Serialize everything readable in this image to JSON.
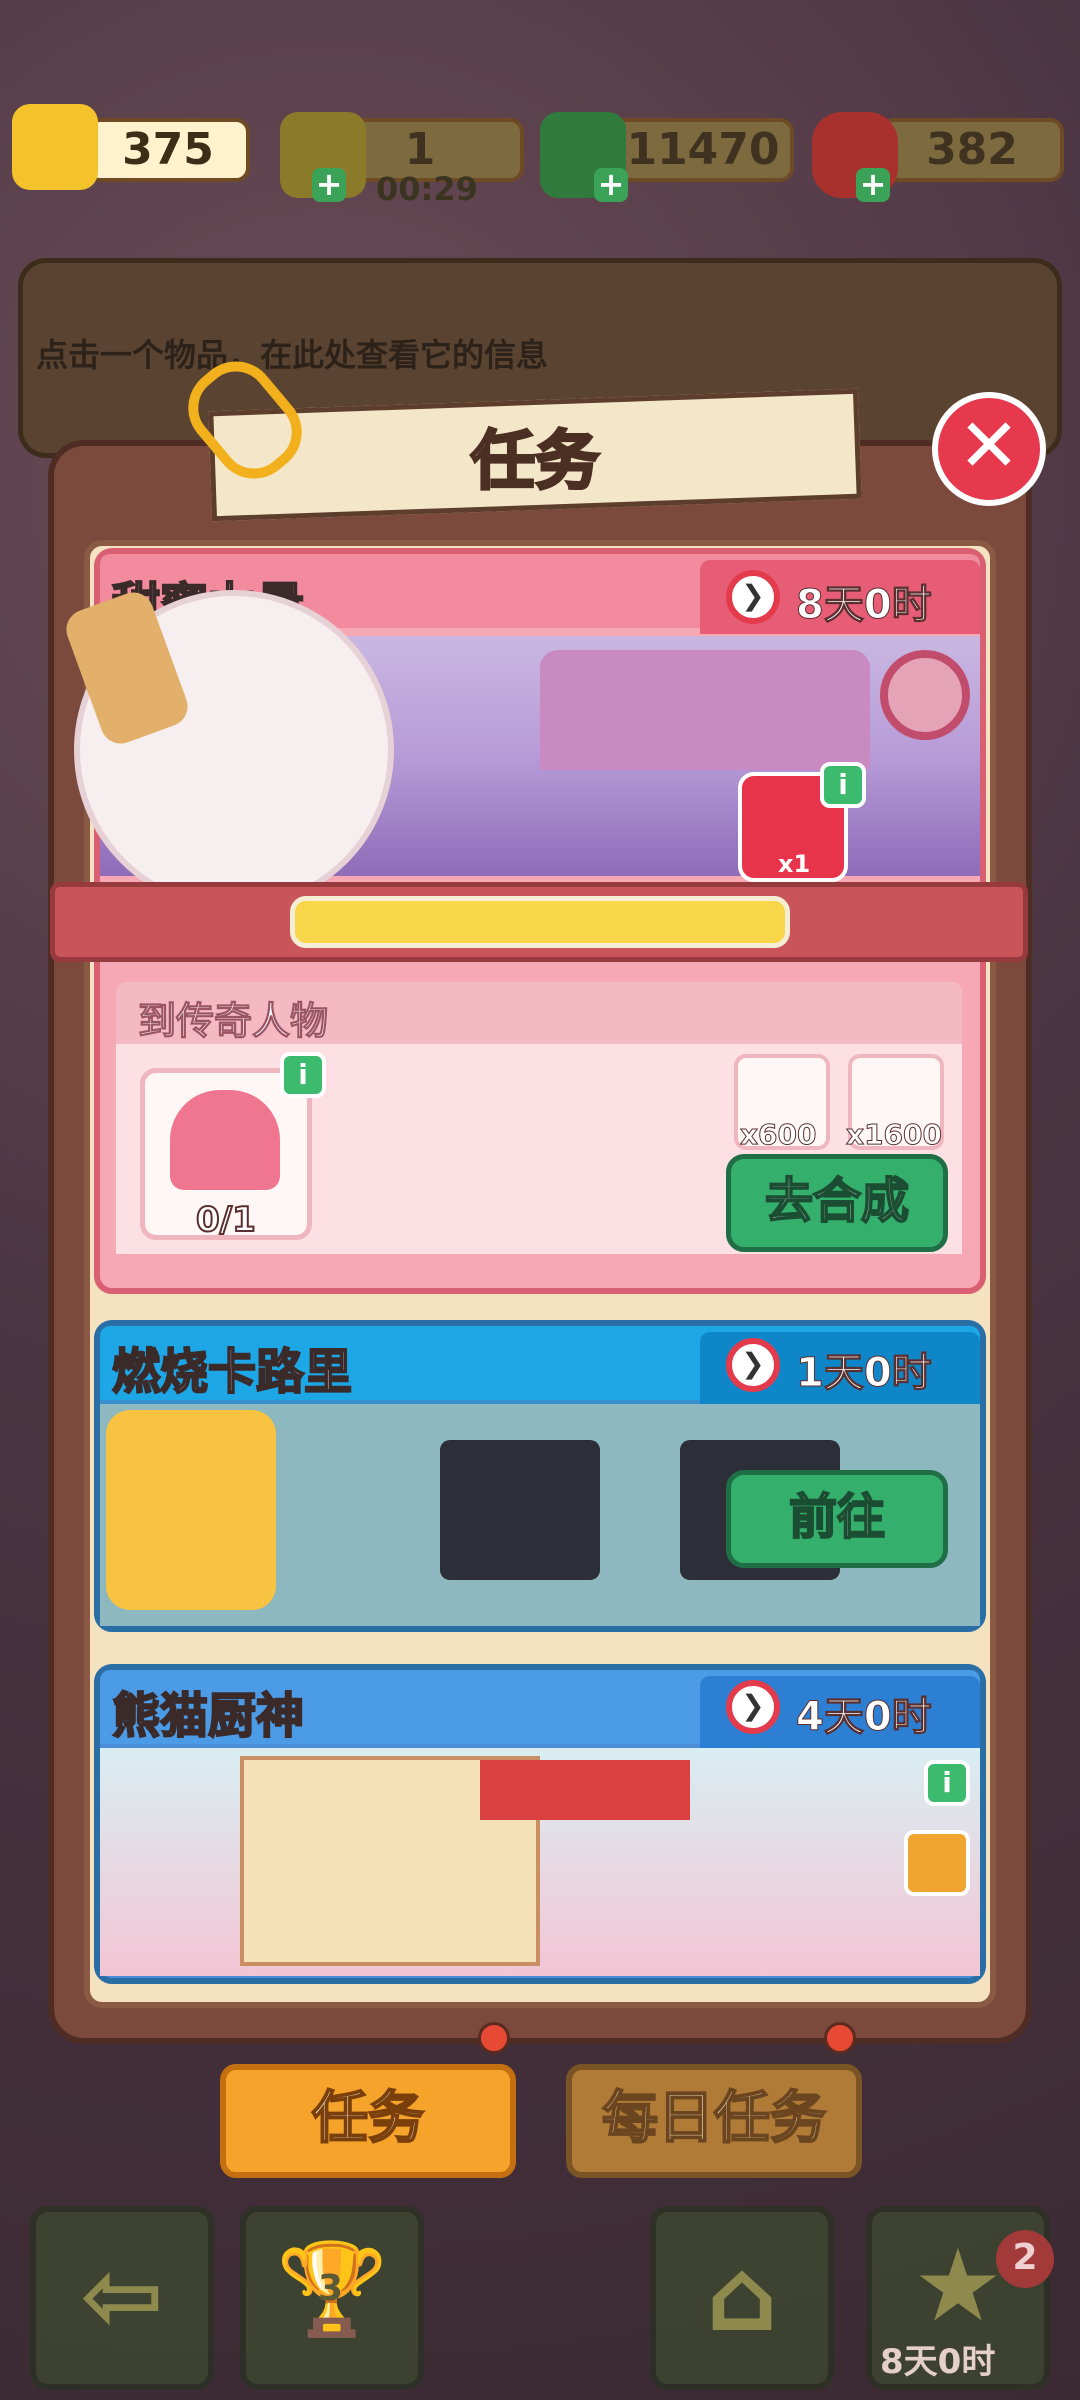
{
  "currencies": [
    {
      "name": "tickets",
      "value": "375"
    },
    {
      "name": "energy",
      "value": "1",
      "sub": "00:29"
    },
    {
      "name": "cash",
      "value": "11470"
    },
    {
      "name": "gems",
      "value": "382"
    }
  ],
  "info_text": "点击一个物品，在此处查看它的信息",
  "modal": {
    "title": "任务"
  },
  "quests": [
    {
      "title": "甜蜜力量",
      "timer": "8天0时",
      "gift_qty": "x1",
      "subtask": "到传奇人物",
      "progress": "0/1",
      "rewards": [
        {
          "label": "x600"
        },
        {
          "label": "x1600"
        }
      ],
      "action": "去合成"
    },
    {
      "title": "燃烧卡路里",
      "timer": "1天0时",
      "action": "前往"
    },
    {
      "title": "熊猫厨神",
      "timer": "4天0时"
    }
  ],
  "tabs": {
    "active": "任务",
    "inactive": "每日任务"
  },
  "bottom_nav": {
    "trophy_num": "3",
    "star_badge": "2",
    "timer": "8天0时"
  },
  "icons": {
    "timer": "❯",
    "info": "i",
    "close": "✕",
    "back": "⇦",
    "trophy": "🏆",
    "basket": "⌂",
    "star": "★"
  }
}
